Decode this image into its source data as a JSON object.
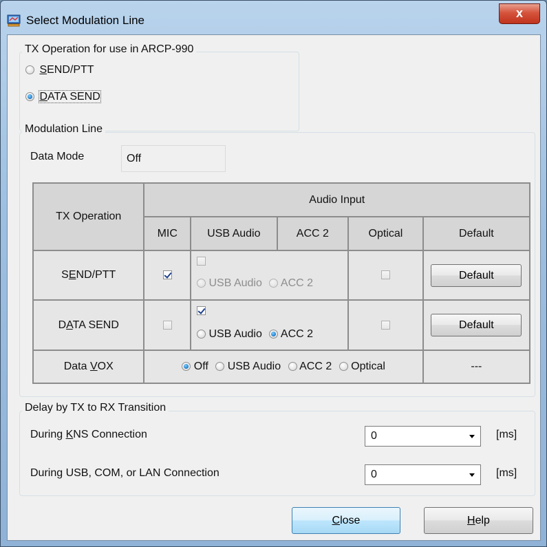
{
  "window": {
    "title": "Select Modulation Line",
    "close_glyph": "x",
    "icon": "app-icon"
  },
  "tx_operation": {
    "legend": "TX Operation for use in ARCP-990",
    "options": [
      {
        "label_pre": "",
        "label_ul": "S",
        "label_post": "END/PTT",
        "selected": false
      },
      {
        "label_pre": "",
        "label_ul": "D",
        "label_post": "ATA SEND",
        "selected": true
      }
    ]
  },
  "modulation": {
    "legend": "Modulation Line",
    "data_mode_label": "Data Mode",
    "data_mode_value": "Off",
    "table": {
      "tx_operation_header": "TX Operation",
      "audio_input_header": "Audio Input",
      "col_mic": "MIC",
      "col_usb": "USB Audio",
      "col_acc2": "ACC 2",
      "col_optical": "Optical",
      "col_default": "Default",
      "rows": [
        {
          "label_pre": "S",
          "label_ul": "E",
          "label_post": "ND/PTT",
          "mic": true,
          "usb_acc_check": false,
          "usb_radio": "USB Audio",
          "acc_radio": "ACC 2",
          "usb_selected": false,
          "acc_selected": false,
          "enabled": false,
          "optical": false,
          "default_button": "Default"
        },
        {
          "label_pre": "D",
          "label_ul": "A",
          "label_post": "TA SEND",
          "mic": false,
          "usb_acc_check": true,
          "usb_radio": "USB Audio",
          "acc_radio": "ACC 2",
          "usb_selected": false,
          "acc_selected": true,
          "enabled": true,
          "optical": false,
          "default_button": "Default"
        }
      ],
      "vox": {
        "label_pre": "Data ",
        "label_ul": "V",
        "label_post": "OX",
        "options": [
          "Off",
          "USB Audio",
          "ACC 2",
          "Optical"
        ],
        "selected": "Off",
        "default_text": "---"
      }
    }
  },
  "delay": {
    "legend": "Delay by TX to RX Transition",
    "kns_label_pre": "During ",
    "kns_label_ul": "K",
    "kns_label_post": "NS Connection",
    "kns_value": "0",
    "usb_label": "During USB, COM, or LAN Connection",
    "usb_value": "0",
    "unit": "[ms]"
  },
  "buttons": {
    "close_ul": "C",
    "close_rest": "lose",
    "help_ul": "H",
    "help_rest": "elp"
  }
}
